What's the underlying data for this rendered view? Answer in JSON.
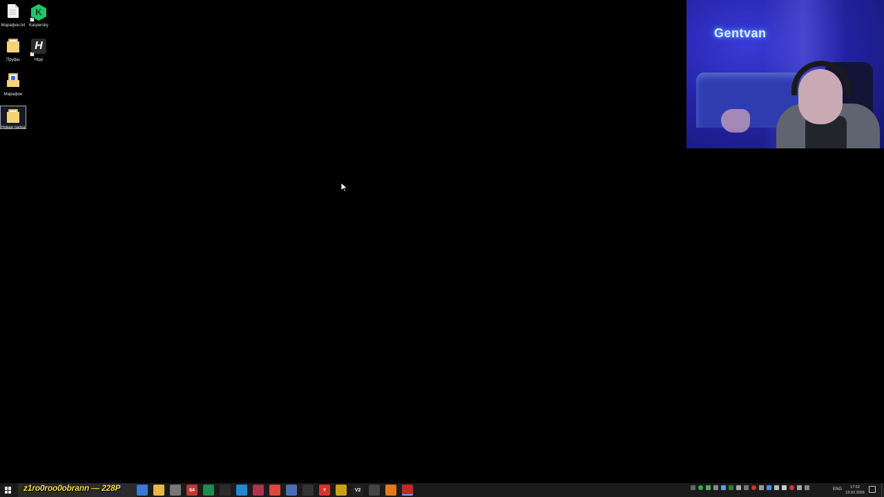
{
  "desktop": {
    "icons": [
      {
        "label": "Марафон.txt",
        "icon": "text-file-icon"
      },
      {
        "label": "Kaspersky",
        "icon": "kaspersky-icon"
      },
      {
        "label": "Пруфы",
        "icon": "folder-icon"
      },
      {
        "label": "Hipp",
        "icon": "hipp-icon"
      },
      {
        "label": "Марафон",
        "icon": "folder-icon"
      },
      {
        "label": "Новая папка",
        "icon": "folder-icon"
      }
    ]
  },
  "webcam": {
    "neon_sign": "Gentvan"
  },
  "taskbar": {
    "search_overlay_text": "z1ro0roo0obrann — 228P",
    "apps": [
      {
        "name": "steam-like",
        "text": "",
        "color": "#3b78d8"
      },
      {
        "name": "file-explorer",
        "text": "",
        "color": "#e8b64a"
      },
      {
        "name": "tool",
        "text": "",
        "color": "#777777"
      },
      {
        "name": "aida64",
        "text": "64",
        "color": "#c0392b"
      },
      {
        "name": "pycharm",
        "text": "",
        "color": "#1f8a4c"
      },
      {
        "name": "epic",
        "text": "",
        "color": "#2c2c2c"
      },
      {
        "name": "edge",
        "text": "",
        "color": "#1e88d0"
      },
      {
        "name": "app-red",
        "text": "",
        "color": "#b03050"
      },
      {
        "name": "chrome",
        "text": "",
        "color": "#d94a3a"
      },
      {
        "name": "calculator",
        "text": "",
        "color": "#4a6fb0"
      },
      {
        "name": "epic-games",
        "text": "",
        "color": "#333333"
      },
      {
        "name": "yandex",
        "text": "Y",
        "color": "#d9302b"
      },
      {
        "name": "app-yellow",
        "text": "",
        "color": "#c9a21a"
      },
      {
        "name": "v2",
        "text": "V2",
        "color": "#222222"
      },
      {
        "name": "steam",
        "text": "",
        "color": "#444444"
      },
      {
        "name": "app-orange",
        "text": "",
        "color": "#e07a1a"
      },
      {
        "name": "app-red2",
        "text": "",
        "color": "#c62828"
      }
    ],
    "language": "ENG",
    "time": "17:52",
    "date": "13.02.2026"
  }
}
